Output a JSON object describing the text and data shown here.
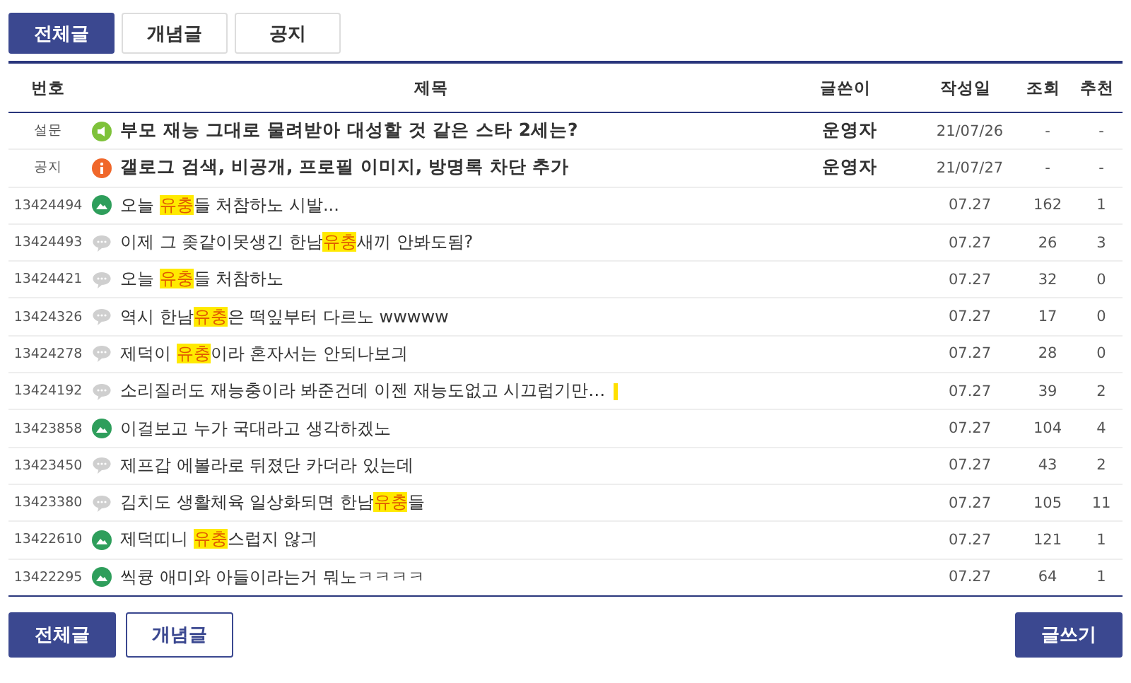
{
  "tabs": [
    {
      "label": "전체글",
      "selected": true
    },
    {
      "label": "개념글",
      "selected": false
    },
    {
      "label": "공지",
      "selected": false
    }
  ],
  "table": {
    "columns": [
      "번호",
      "제목",
      "글쓴이",
      "작성일",
      "조회",
      "추천"
    ],
    "rows": [
      {
        "number": "설문",
        "kind": "survey",
        "bold": true,
        "title": [
          {
            "text": "부모 재능 그대로 물려받아 대성할 것 같은 스타 2세는?",
            "highlight": false
          }
        ],
        "writer": "운영자",
        "date": "21/07/26",
        "views": "-",
        "recommend": "-"
      },
      {
        "number": "공지",
        "kind": "notice",
        "bold": true,
        "title": [
          {
            "text": "갤로그 검색, 비공개, 프로필 이미지, 방명록 차단 추가",
            "highlight": false
          }
        ],
        "writer": "운영자",
        "date": "21/07/27",
        "views": "-",
        "recommend": "-"
      },
      {
        "number": "13424494",
        "kind": "image",
        "bold": false,
        "title": [
          {
            "text": "오늘 ",
            "highlight": false
          },
          {
            "text": "유충",
            "highlight": true
          },
          {
            "text": "들 처참하노 시발...",
            "highlight": false
          }
        ],
        "date": "07.27",
        "views": "162",
        "recommend": "1"
      },
      {
        "number": "13424493",
        "kind": "text",
        "bold": false,
        "title": [
          {
            "text": "이제 그 좆같이못생긴 한남",
            "highlight": false
          },
          {
            "text": "유충",
            "highlight": true
          },
          {
            "text": "새끼 안봐도됨?",
            "highlight": false
          }
        ],
        "date": "07.27",
        "views": "26",
        "recommend": "3"
      },
      {
        "number": "13424421",
        "kind": "text",
        "bold": false,
        "title": [
          {
            "text": "오늘 ",
            "highlight": false
          },
          {
            "text": "유충",
            "highlight": true
          },
          {
            "text": "들 처참하노",
            "highlight": false
          }
        ],
        "date": "07.27",
        "views": "32",
        "recommend": "0"
      },
      {
        "number": "13424326",
        "kind": "text",
        "bold": false,
        "title": [
          {
            "text": "역시 한남",
            "highlight": false
          },
          {
            "text": "유충",
            "highlight": true
          },
          {
            "text": "은 떡잎부터 다르노 wwwww",
            "highlight": false
          }
        ],
        "date": "07.27",
        "views": "17",
        "recommend": "0"
      },
      {
        "number": "13424278",
        "kind": "text",
        "bold": false,
        "title": [
          {
            "text": "제덕이 ",
            "highlight": false
          },
          {
            "text": "유충",
            "highlight": true
          },
          {
            "text": "이라 혼자서는 안되나보긔",
            "highlight": false
          }
        ],
        "date": "07.27",
        "views": "28",
        "recommend": "0"
      },
      {
        "number": "13424192",
        "kind": "text",
        "bold": false,
        "title": [
          {
            "text": "소리질러도 재능충이라 봐준건데 이젠 재능도없고 시끄럽기만…",
            "highlight": false
          }
        ],
        "trailing_highlight": true,
        "date": "07.27",
        "views": "39",
        "recommend": "2"
      },
      {
        "number": "13423858",
        "kind": "image",
        "bold": false,
        "title": [
          {
            "text": "이걸보고 누가 국대라고 생각하겠노",
            "highlight": false
          }
        ],
        "date": "07.27",
        "views": "104",
        "recommend": "4"
      },
      {
        "number": "13423450",
        "kind": "text",
        "bold": false,
        "title": [
          {
            "text": "제프갑 에볼라로 뒤졌단 카더라 있는데",
            "highlight": false
          }
        ],
        "date": "07.27",
        "views": "43",
        "recommend": "2"
      },
      {
        "number": "13423380",
        "kind": "text",
        "bold": false,
        "title": [
          {
            "text": "김치도 생활체육 일상화되면 한남",
            "highlight": false
          },
          {
            "text": "유충",
            "highlight": true
          },
          {
            "text": "들",
            "highlight": false
          }
        ],
        "date": "07.27",
        "views": "105",
        "recommend": "11"
      },
      {
        "number": "13422610",
        "kind": "image",
        "bold": false,
        "title": [
          {
            "text": "제덕띠니 ",
            "highlight": false
          },
          {
            "text": "유충",
            "highlight": true
          },
          {
            "text": "스럽지 않긔",
            "highlight": false
          }
        ],
        "date": "07.27",
        "views": "121",
        "recommend": "1"
      },
      {
        "number": "13422295",
        "kind": "image",
        "bold": false,
        "title": [
          {
            "text": "씩큥 애미와 아들이라는거 뭐노ㅋㅋㅋㅋ",
            "highlight": false
          }
        ],
        "date": "07.27",
        "views": "64",
        "recommend": "1"
      }
    ]
  },
  "bottom_buttons": [
    {
      "label": "전체글",
      "selected": true
    },
    {
      "label": "개념글",
      "selected": false
    }
  ],
  "write_button": "글쓰기"
}
